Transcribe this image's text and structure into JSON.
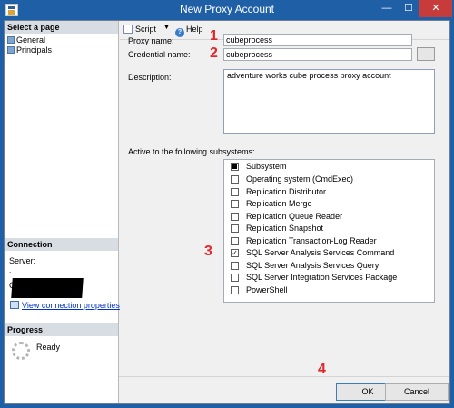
{
  "window": {
    "title": "New Proxy Account",
    "min_icon": "minimize-icon",
    "max_icon": "maximize-icon",
    "close_icon": "close-icon",
    "minimize_glyph": "—",
    "maximize_glyph": "☐",
    "close_glyph": "✕"
  },
  "left_pane": {
    "select_page_header": "Select a page",
    "pages": [
      {
        "label": "General"
      },
      {
        "label": "Principals"
      }
    ],
    "connection_header": "Connection",
    "server_label": "Server:",
    "server_value": ".",
    "connection_prefix": "C",
    "view_connection_link": "View connection properties",
    "progress_header": "Progress",
    "progress_status": "Ready"
  },
  "toolbar": {
    "script_label": "Script",
    "script_arrow": "▼",
    "help_label": "Help",
    "help_glyph": "?"
  },
  "form": {
    "proxy_name_label": "Proxy name:",
    "proxy_name_value": "cubeprocess",
    "credential_name_label": "Credential name:",
    "credential_name_value": "cubeprocess",
    "browse_label": "...",
    "description_label": "Description:",
    "description_value": "adventure works cube process proxy account",
    "subsystems_label": "Active to the following subsystems:",
    "subsystems_header": "Subsystem",
    "subsystems": [
      {
        "label": "Operating system (CmdExec)",
        "checked": false
      },
      {
        "label": "Replication Distributor",
        "checked": false
      },
      {
        "label": "Replication Merge",
        "checked": false
      },
      {
        "label": "Replication Queue Reader",
        "checked": false
      },
      {
        "label": "Replication Snapshot",
        "checked": false
      },
      {
        "label": "Replication Transaction-Log Reader",
        "checked": false
      },
      {
        "label": "SQL Server Analysis Services Command",
        "checked": true
      },
      {
        "label": "SQL Server Analysis Services Query",
        "checked": false
      },
      {
        "label": "SQL Server Integration Services Package",
        "checked": false
      },
      {
        "label": "PowerShell",
        "checked": false
      }
    ],
    "checked_glyph": "✓"
  },
  "annotations": {
    "one": "1",
    "two": "2",
    "three": "3",
    "four": "4",
    "color": "#e0262c"
  },
  "buttons": {
    "ok_label": "OK",
    "cancel_label": "Cancel"
  },
  "colors": {
    "title_bar": "#1e5fa6",
    "pane_header": "#d8dde4",
    "link": "#0033cc"
  }
}
